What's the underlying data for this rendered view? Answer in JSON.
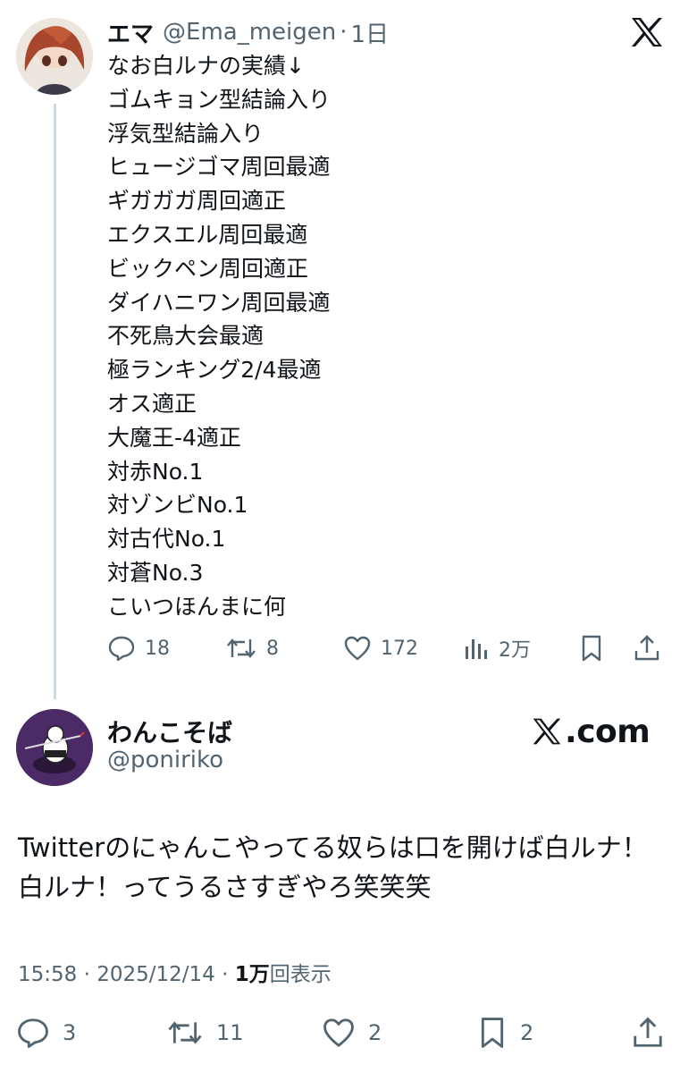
{
  "tweet1": {
    "author_name": "エマ",
    "handle": "@Ema_meigen",
    "separator": "·",
    "time": "1日",
    "lines": [
      "なお白ルナの実績↓",
      "ゴムキョン型結論入り",
      "浮気型結論入り",
      "ヒュージゴマ周回最適",
      "ギガガガ周回適正",
      "エクスエル周回最適",
      "ビックペン周回適正",
      "ダイハニワン周回最適",
      "不死鳥大会最適",
      "極ランキング2/4最適",
      "オス適正",
      "大魔王-4適正",
      "対赤No.1",
      "対ゾンビNo.1",
      "対古代No.1",
      "対蒼No.3",
      "こいつほんまに何"
    ],
    "actions": {
      "reply_icon": "reply-icon",
      "replies": "18",
      "retweet_icon": "retweet-icon",
      "retweets": "8",
      "like_icon": "heart-icon",
      "likes": "172",
      "views_icon": "views-icon",
      "views": "2万",
      "bookmark_icon": "bookmark-icon",
      "share_icon": "share-icon"
    },
    "x_logo": "x-logo-icon"
  },
  "tweet2": {
    "author_name": "わんこそば",
    "handle": "@poniriko",
    "brand_text": "com",
    "brand_dot": ".",
    "text": "Twitterのにゃんこやってる奴らは口を開けば白ルナ！白ルナ！ってうるさすぎやろ笑笑笑",
    "meta": {
      "time": "15:58",
      "separator": " · ",
      "date": "2025/12/14",
      "views_count": "1万",
      "views_label": "回表示"
    },
    "actions": {
      "replies": "3",
      "retweets": "11",
      "likes": "2",
      "bookmarks": "2"
    }
  },
  "colors": {
    "text": "#0f1419",
    "secondary": "#536471",
    "thread_line": "#cfd9de",
    "background": "#ffffff"
  }
}
